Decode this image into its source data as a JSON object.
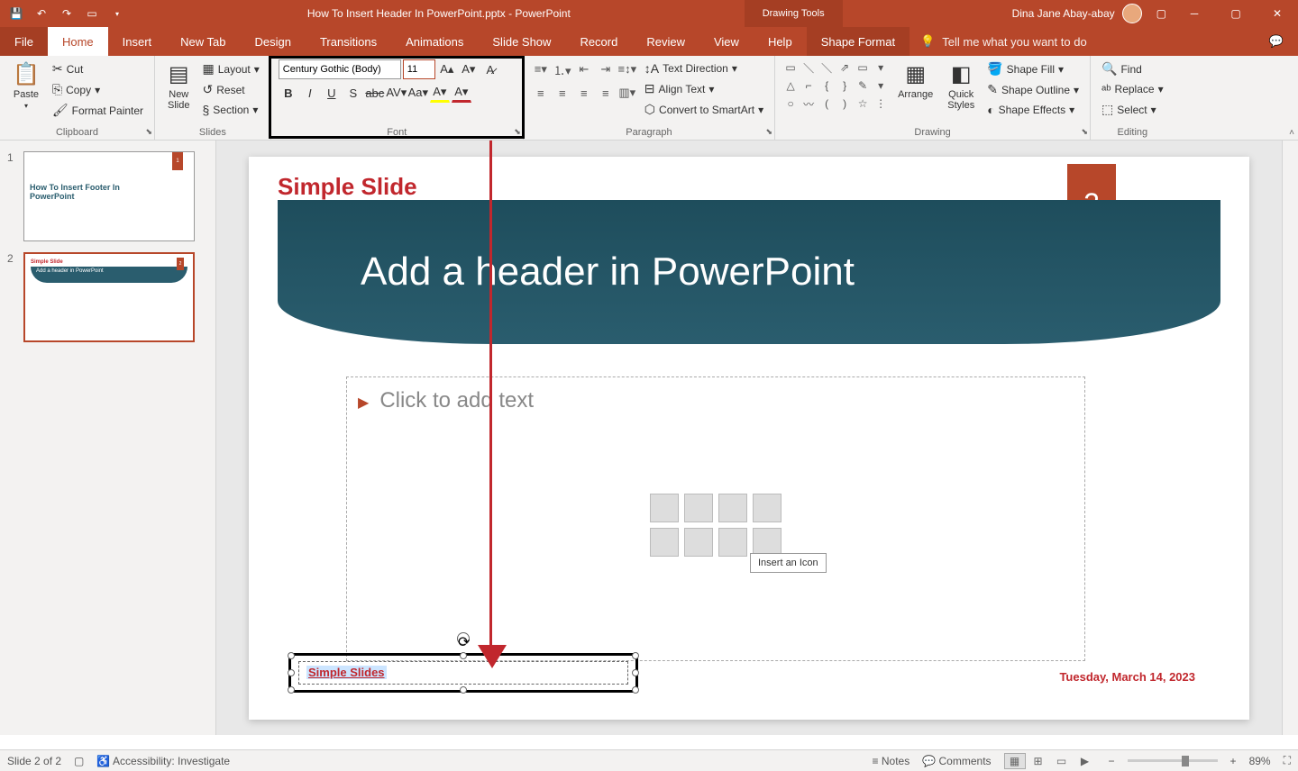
{
  "titlebar": {
    "doc_title": "How To Insert Header In PowerPoint.pptx - PowerPoint",
    "tools_tab": "Drawing Tools",
    "user_name": "Dina Jane Abay-abay"
  },
  "tabs": {
    "file": "File",
    "home": "Home",
    "insert": "Insert",
    "newtab": "New Tab",
    "design": "Design",
    "transitions": "Transitions",
    "animations": "Animations",
    "slideshow": "Slide Show",
    "record": "Record",
    "review": "Review",
    "view": "View",
    "help": "Help",
    "shapeformat": "Shape Format",
    "tellme": "Tell me what you want to do"
  },
  "ribbon": {
    "clipboard": {
      "label": "Clipboard",
      "paste": "Paste",
      "cut": "Cut",
      "copy": "Copy",
      "format_painter": "Format Painter"
    },
    "slides": {
      "label": "Slides",
      "new_slide": "New\nSlide",
      "layout": "Layout",
      "reset": "Reset",
      "section": "Section"
    },
    "font": {
      "label": "Font",
      "name": "Century Gothic (Body)",
      "size": "11"
    },
    "paragraph": {
      "label": "Paragraph",
      "text_direction": "Text Direction",
      "align_text": "Align Text",
      "convert_smartart": "Convert to SmartArt"
    },
    "drawing": {
      "label": "Drawing",
      "arrange": "Arrange",
      "quick_styles": "Quick\nStyles",
      "shape_fill": "Shape Fill",
      "shape_outline": "Shape Outline",
      "shape_effects": "Shape Effects"
    },
    "editing": {
      "label": "Editing",
      "find": "Find",
      "replace": "Replace",
      "select": "Select"
    }
  },
  "thumbs": {
    "t1_title": "How To Insert Footer In\nPowerPoint",
    "t2_label": "Simple Slide",
    "t2_header": "Add a header in PowerPoint"
  },
  "slide": {
    "annotation": "Simple Slide",
    "number": "2",
    "header": "Add a header in PowerPoint",
    "placeholder": "Click to add text",
    "tooltip": "Insert an Icon",
    "footer_text": "Simple Slides",
    "date": "Tuesday, March 14, 2023"
  },
  "statusbar": {
    "slide_info": "Slide 2 of 2",
    "accessibility": "Accessibility: Investigate",
    "notes": "Notes",
    "comments": "Comments",
    "zoom": "89%"
  }
}
